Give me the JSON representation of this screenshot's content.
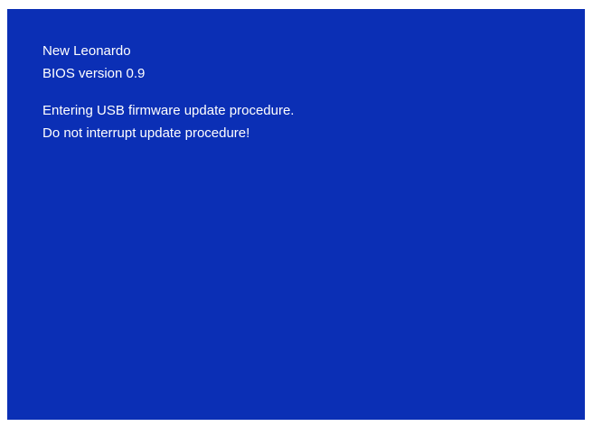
{
  "screen": {
    "background_color": "#0b2fb5",
    "text_color": "#ffffff",
    "lines": [
      "New Leonardo",
      "BIOS version 0.9",
      "Entering USB firmware update procedure.",
      "Do not interrupt update procedure!"
    ]
  }
}
